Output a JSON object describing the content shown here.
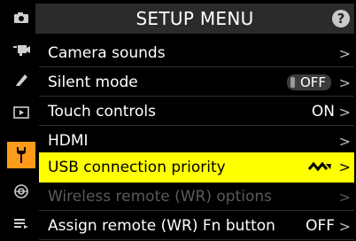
{
  "header": {
    "title": "SETUP MENU",
    "help": "?"
  },
  "sidebar": {
    "tabs": [
      {
        "icon": "camera-icon",
        "active": false
      },
      {
        "icon": "movie-camera-icon",
        "active": false
      },
      {
        "icon": "pencil-icon",
        "active": false
      },
      {
        "icon": "playback-icon",
        "active": false
      },
      {
        "icon": "wrench-icon",
        "active": true
      },
      {
        "icon": "network-icon",
        "active": false
      },
      {
        "icon": "my-menu-icon",
        "active": false
      }
    ]
  },
  "menu": {
    "items": [
      {
        "label": "Camera sounds",
        "value": "",
        "chevron": ">"
      },
      {
        "label": "Silent mode",
        "value": "OFF",
        "chevron": ">"
      },
      {
        "label": "Touch controls",
        "value": "ON",
        "chevron": ">"
      },
      {
        "label": "HDMI",
        "value": "",
        "chevron": ">"
      },
      {
        "label": "USB connection priority",
        "value": "",
        "chevron": ">"
      },
      {
        "label": "Wireless remote (WR) options",
        "value": "",
        "chevron": ">"
      },
      {
        "label": "Assign remote (WR) Fn button",
        "value": "OFF",
        "chevron": ">"
      }
    ]
  },
  "colors": {
    "selected": "#ffff00",
    "active_tab": "#ff9b1a",
    "header_bg": "#2b2b2b"
  }
}
